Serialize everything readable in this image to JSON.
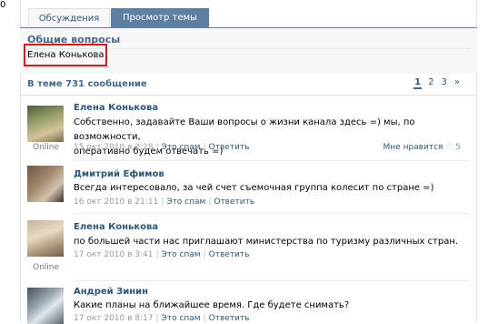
{
  "tabs": [
    {
      "label": "Обсуждения",
      "active": false
    },
    {
      "label": "Просмотр темы",
      "active": true
    }
  ],
  "topic": {
    "title": "Общие вопросы",
    "author": "Елена Конькова"
  },
  "thread": {
    "count_text": "В теме 731 сообщение",
    "pages": [
      "1",
      "2",
      "3",
      "»"
    ],
    "current_page": "1"
  },
  "posts": [
    {
      "author": "Елена Конькова",
      "text_line1": "Собственно, задавайте Ваши вопросы о жизни канала здесь =) мы, по возможности,",
      "text_line2": "оперативно будем отвечать =)",
      "date": "15 окт 2010 в 2:28",
      "spam_label": "Это спам",
      "reply_label": "Ответить",
      "status": "Online",
      "likes_label": "Мне нравится",
      "likes_count": "5"
    },
    {
      "author": "Дмитрий Ефимов",
      "text_line1": "Всегда интересовало, за чей счет съемочная группа колесит по стране =)",
      "date": "16 окт 2010 в 21:11",
      "spam_label": "Это спам",
      "reply_label": "Ответить"
    },
    {
      "author": "Елена Конькова",
      "text_line1": "по большей части нас приглашают министерства по туризму различных стран.",
      "date": "17 окт 2010 в 3:41",
      "spam_label": "Это спам",
      "reply_label": "Ответить",
      "status": "Online"
    },
    {
      "author": "Андрей Зинин",
      "text_line1": "Какие планы на ближайшее время. Где будете снимать?",
      "date": "17 окт 2010 в 8:17",
      "spam_label": "Это спам",
      "reply_label": "Ответить"
    }
  ],
  "colors": {
    "accent": "#5d7fa3",
    "link": "#2b587a",
    "highlight_box": "#e3161b"
  },
  "icons": {
    "like": "heart-icon"
  }
}
